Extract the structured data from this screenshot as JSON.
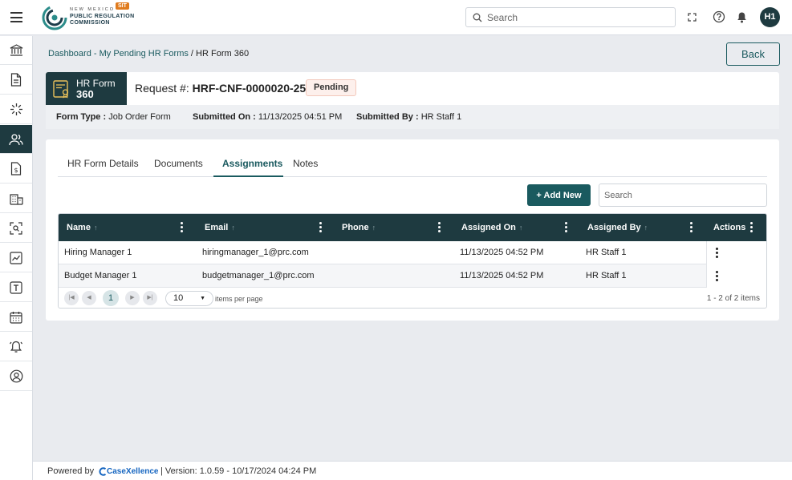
{
  "header": {
    "logo": {
      "line1": "NEW MEXICO",
      "line2": "PUBLIC REGULATION",
      "line3": "COMMISSION",
      "env_badge": "SIT"
    },
    "search_placeholder": "Search",
    "avatar_initials": "H1"
  },
  "breadcrumb": {
    "dashboard": "Dashboard",
    "sep1": " - ",
    "pending": "My Pending HR Forms",
    "sep2": " / ",
    "current": "HR Form 360"
  },
  "back_label": "Back",
  "request": {
    "form_tag_line1": "HR Form",
    "form_tag_line2": "360",
    "label": "Request #:",
    "number": "HRF-CNF-0000020-25",
    "status": "Pending"
  },
  "meta": {
    "form_type_label": "Form Type :",
    "form_type": "Job Order Form",
    "submitted_on_label": "Submitted On :",
    "submitted_on": "11/13/2025 04:51 PM",
    "submitted_by_label": "Submitted By :",
    "submitted_by": "HR Staff 1"
  },
  "tabs": [
    "HR Form Details",
    "Documents",
    "Assignments",
    "Notes"
  ],
  "active_tab": "Assignments",
  "toolbar": {
    "add_label": "+ Add New",
    "search_placeholder": "Search"
  },
  "grid": {
    "columns": [
      "Name",
      "Email",
      "Phone",
      "Assigned On",
      "Assigned By",
      "Actions"
    ],
    "rows": [
      {
        "name": "Hiring Manager 1",
        "email": "hiringmanager_1@prc.com",
        "phone": "",
        "assigned_on": "11/13/2025 04:52 PM",
        "assigned_by": "HR Staff 1"
      },
      {
        "name": "Budget Manager 1",
        "email": "budgetmanager_1@prc.com",
        "phone": "",
        "assigned_on": "11/13/2025 04:52 PM",
        "assigned_by": "HR Staff 1"
      }
    ]
  },
  "pager": {
    "current_page": "1",
    "page_size": "10",
    "items_per_page": "items per page",
    "count": "1 - 2 of 2 items"
  },
  "footer": {
    "powered_by": "Powered by",
    "brand": "CaseXellence",
    "version": "|  Version: 1.0.59 - 10/17/2024 04:24 PM"
  },
  "colors": {
    "primary": "#1e3a40",
    "accent": "#1a5a5f",
    "env_badge": "#e07b1d",
    "pending_bg": "#fdf0ec"
  },
  "sidebar_icons": [
    "bank-icon",
    "document-icon",
    "sparkle-icon",
    "users-icon",
    "dollar-document-icon",
    "building-icon",
    "search-user-icon",
    "chart-icon",
    "template-icon",
    "calendar-icon",
    "alarm-icon",
    "user-circle-icon"
  ],
  "sidebar_active_index": 3
}
